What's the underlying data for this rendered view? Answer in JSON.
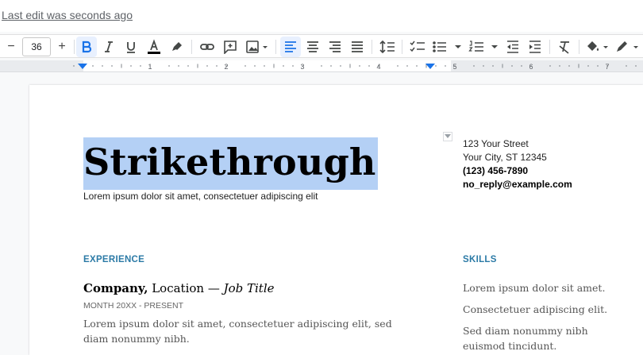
{
  "header": {
    "last_edit": "Last edit was seconds ago"
  },
  "toolbar": {
    "font_size": "36",
    "decrease_label": "−",
    "increase_label": "+",
    "text_color": "#000000",
    "active_color": "#e8f0fe",
    "icon_color": "#444746"
  },
  "ruler": {
    "numbers": [
      "1",
      "2",
      "3",
      "4",
      "5",
      "6",
      "7"
    ],
    "indent_marker_color": "#1a73e8"
  },
  "document": {
    "title": "Strikethrough",
    "subtitle": "Lorem ipsum dolor sit amet, consectetuer adipiscing elit",
    "selection_color": "#b4d0f5",
    "contact": {
      "street": "123 Your Street",
      "city": "Your City, ST 12345",
      "phone": "(123) 456-7890",
      "email": "no_reply@example.com"
    },
    "experience": {
      "heading": "EXPERIENCE",
      "heading_color": "#2b7aa6",
      "company": "Company,",
      "location": " Location — ",
      "job_title": "Job Title",
      "dates": "MONTH 20XX - PRESENT",
      "description": "Lorem ipsum dolor sit amet, consectetuer adipiscing elit, sed diam nonummy nibh."
    },
    "skills": {
      "heading": "SKILLS",
      "items": [
        "Lorem ipsum dolor sit amet.",
        "Consectetuer adipiscing elit.",
        "Sed diam nonummy nibh euismod tincidunt."
      ]
    }
  }
}
